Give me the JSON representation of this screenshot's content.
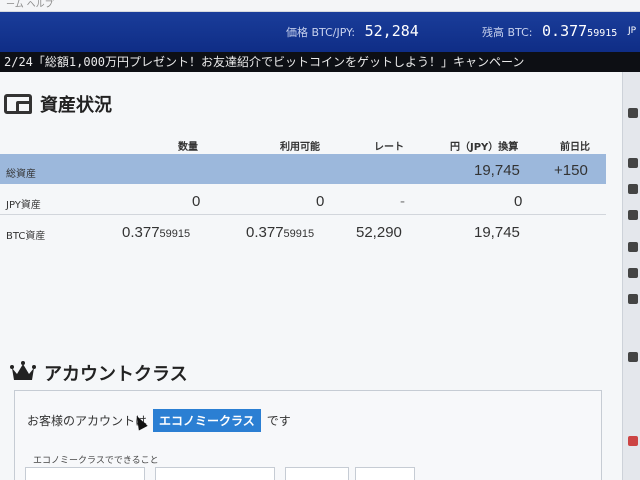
{
  "top_strip": {
    "text": "ーム  ヘルプ"
  },
  "header": {
    "price_label": "価格 BTC/JPY:",
    "price_value": "52,284",
    "balance_label": "残高 BTC:",
    "balance_main": "0.377",
    "balance_small": "59915",
    "right_stub": "JP"
  },
  "ticker": {
    "text": "2/24「総額1,000万円プレゼント！お友達紹介でビットコインをゲットしよう！」キャンペーン"
  },
  "assets": {
    "title": "資産状況",
    "columns": {
      "quantity": "数量",
      "available": "利用可能",
      "rate": "レート",
      "jpy": "円（JPY）換算",
      "change": "前日比"
    },
    "rows": [
      {
        "label": "総資産",
        "quantity": "",
        "available": "",
        "rate": "",
        "jpy": "19,745",
        "change": "+150"
      },
      {
        "label": "JPY資産",
        "quantity": "0",
        "available": "0",
        "rate": "-",
        "jpy": "0",
        "change": ""
      },
      {
        "label": "BTC資産",
        "quantity_main": "0.377",
        "quantity_small": "59915",
        "available_main": "0.377",
        "available_small": "59915",
        "rate": "52,290",
        "jpy": "19,745",
        "change": ""
      }
    ]
  },
  "account": {
    "title": "アカウントクラス",
    "text_before": "お客様のアカウントは",
    "class_badge": "エコノミークラス",
    "text_after": "です",
    "subheading": "エコノミークラスでできること"
  },
  "colors": {
    "header_bg": "#0f2d86",
    "highlight_row": "#9cb8dc",
    "badge": "#2b7fd3",
    "ticker_bg": "#0d0f14"
  }
}
